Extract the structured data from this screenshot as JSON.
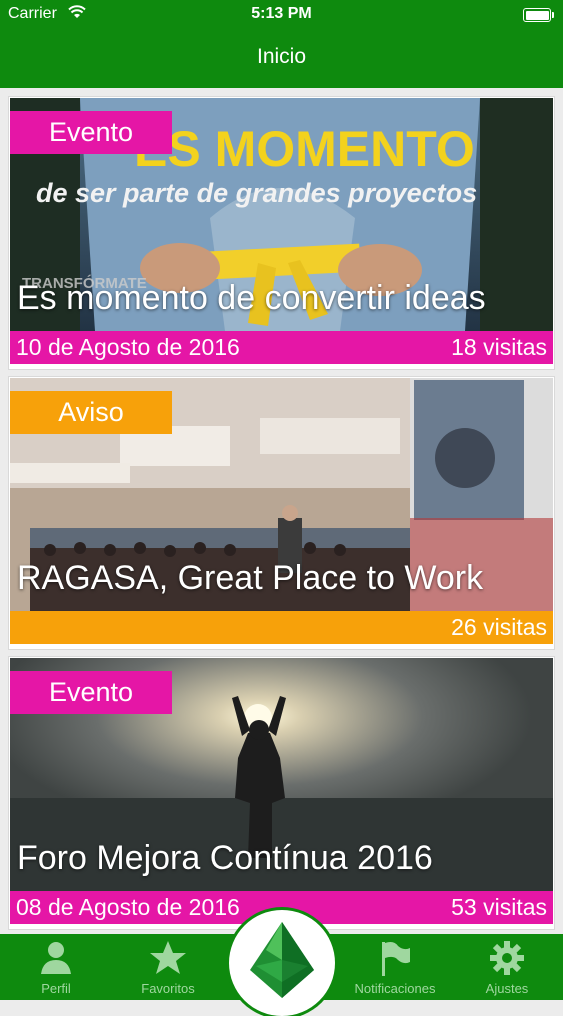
{
  "status_bar": {
    "carrier": "Carrier",
    "time": "5:13 PM"
  },
  "nav": {
    "title": "Inicio"
  },
  "feed": [
    {
      "badge": "Evento",
      "badge_color": "#e516a6",
      "footer_color": "#e516a6",
      "title": "Es momento de convertir ideas",
      "date": "10 de Agosto de 2016",
      "visits": "18 visitas",
      "image_text": {
        "line1": "ES MOMENTO",
        "line2": "de ser parte de grandes proyectos",
        "line3": "TRANSFÓRMATE"
      }
    },
    {
      "badge": "Aviso",
      "badge_color": "#f7a10a",
      "footer_color": "#f7a10a",
      "title": "RAGASA, Great Place to Work",
      "date": "",
      "visits": "26 visitas"
    },
    {
      "badge": "Evento",
      "badge_color": "#e516a6",
      "footer_color": "#e516a6",
      "title": "Foro Mejora Contínua 2016",
      "date": "08 de Agosto de 2016",
      "visits": "53 visitas"
    }
  ],
  "tabbar": {
    "tabs": [
      {
        "label": "Perfil",
        "icon": "person-icon"
      },
      {
        "label": "Favoritos",
        "icon": "star-icon"
      },
      {
        "label": "Notificaciones",
        "icon": "flag-icon"
      },
      {
        "label": "Ajustes",
        "icon": "gear-icon"
      }
    ],
    "center_icon": "leaf-logo-icon"
  },
  "colors": {
    "brand_green": "#0e8a0e",
    "evento": "#e516a6",
    "aviso": "#f7a10a"
  }
}
